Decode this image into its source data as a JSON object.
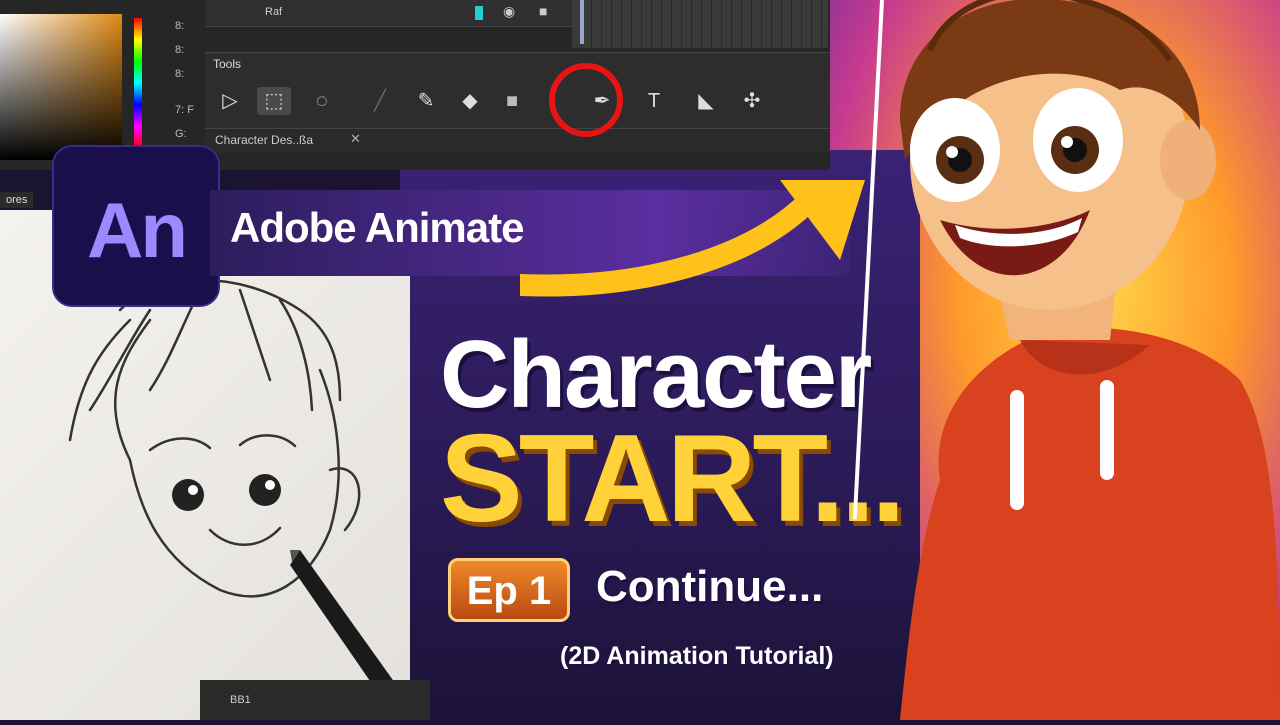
{
  "app": {
    "swatch_labels": [
      "8:",
      "8:",
      "8:",
      "7: F",
      "G:"
    ],
    "properties_label": "ores",
    "layer_name": "Raf",
    "tools_title": "Tools",
    "doc_tab": "Character Des..ßa",
    "doc_tab_close": "✕",
    "bottom_label": "BB1",
    "tool_icons": [
      "selection-arrow-icon",
      "subselection-icon",
      "lasso-icon",
      "brush-icon",
      "paint-brush-icon",
      "eraser-icon",
      "rectangle-icon",
      "pen-icon",
      "text-icon",
      "paint-bucket-icon",
      "bone-icon"
    ]
  },
  "logo": {
    "text": "An"
  },
  "brand": {
    "name": "Adobe Animate"
  },
  "headline": {
    "line1": "Character",
    "line2": "START...",
    "episode": "Ep 1",
    "continue": "Continue...",
    "subtitle": "(2D Animation Tutorial)"
  },
  "colors": {
    "accent_yellow": "#ffd23a",
    "highlight_red": "#e81414",
    "logo_bg": "#1a0f4a",
    "logo_text": "#9a8aff",
    "badge_orange": "#e07020"
  }
}
